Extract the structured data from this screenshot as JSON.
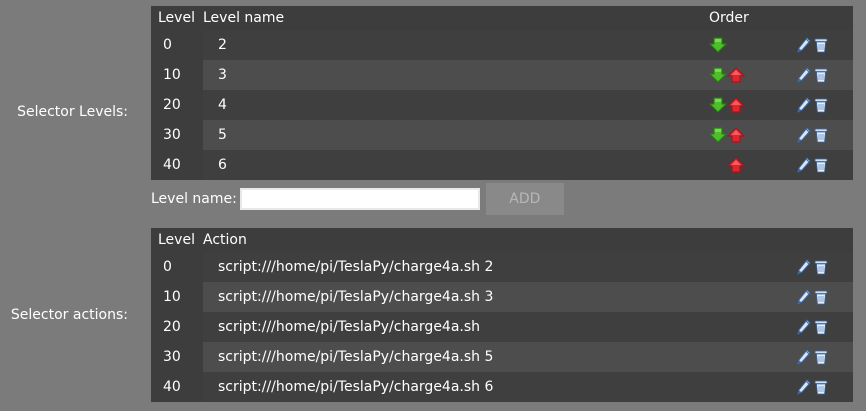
{
  "levels_section": {
    "label": "Selector Levels:",
    "headers": {
      "level": "Level",
      "name": "Level name",
      "order": "Order"
    },
    "rows": [
      {
        "level": "0",
        "name": "2",
        "down": true,
        "up": false
      },
      {
        "level": "10",
        "name": "3",
        "down": true,
        "up": true
      },
      {
        "level": "20",
        "name": "4",
        "down": true,
        "up": true
      },
      {
        "level": "30",
        "name": "5",
        "down": true,
        "up": true
      },
      {
        "level": "40",
        "name": "6",
        "down": false,
        "up": true
      }
    ]
  },
  "level_form": {
    "label": "Level name:",
    "value": "",
    "add_label": "ADD"
  },
  "actions_section": {
    "label": "Selector actions:",
    "headers": {
      "level": "Level",
      "action": "Action"
    },
    "rows": [
      {
        "level": "0",
        "action": "script:///home/pi/TeslaPy/charge4a.sh 2"
      },
      {
        "level": "10",
        "action": "script:///home/pi/TeslaPy/charge4a.sh 3"
      },
      {
        "level": "20",
        "action": "script:///home/pi/TeslaPy/charge4a.sh"
      },
      {
        "level": "30",
        "action": "script:///home/pi/TeslaPy/charge4a.sh 5"
      },
      {
        "level": "40",
        "action": "script:///home/pi/TeslaPy/charge4a.sh 6"
      }
    ]
  },
  "icons": {
    "move_down": "green-down-arrow-icon",
    "move_up": "red-up-arrow-icon",
    "edit": "pencil-icon",
    "delete": "trash-can-icon"
  },
  "colors": {
    "page_bg": "#7b7b7b",
    "header_bg": "#3d3d3d",
    "row_odd": "#3f3f3f",
    "row_even": "#4d4d4d",
    "arrow_down": "#4cbf2a",
    "arrow_up": "#e0252d"
  }
}
